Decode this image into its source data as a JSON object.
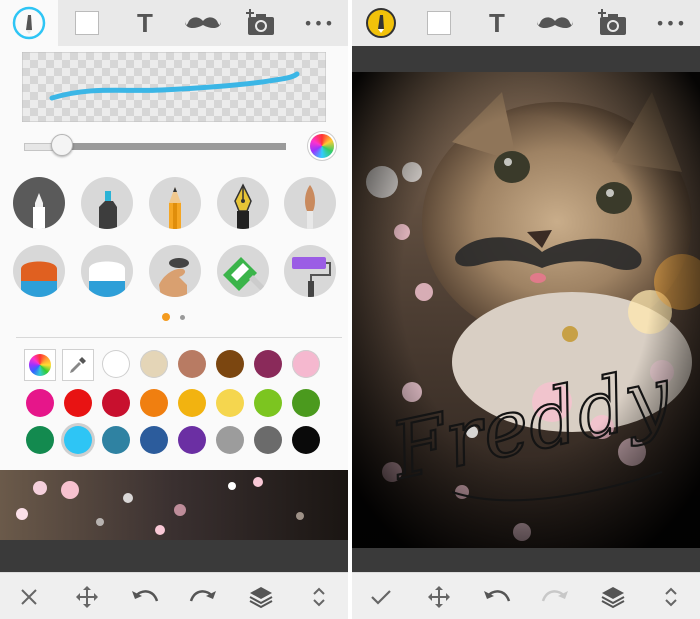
{
  "left": {
    "toolbar": [
      "brush-tool",
      "fill-square",
      "text-tool",
      "mustache-sticker",
      "add-photo",
      "more-options"
    ],
    "text_icon_glyph": "T",
    "more_glyph": "•••",
    "stroke_color": "#3bb6e6",
    "brushes_row1": [
      "marker",
      "highlighter",
      "pencil",
      "fountain-pen",
      "paintbrush"
    ],
    "brushes_row2": [
      "eraser-orange",
      "eraser-white",
      "smudge-finger",
      "glitter-tool",
      "paint-roller"
    ],
    "page_dots": 2,
    "active_page": 1,
    "palette_tools": [
      "color-wheel",
      "eyedropper"
    ],
    "palette": [
      "#ffffff",
      "#e4d5b7",
      "#b87b63",
      "#7b4610",
      "#8a2a5a",
      "#f5b8cf",
      "#e6168a",
      "#e81313",
      "#c8102e",
      "#f07f10",
      "#f2b310",
      "#f5d64e",
      "#7cc520",
      "#4b9a1e",
      "#138a4f",
      "#2ec5f5",
      "#2f82a2",
      "#2c5c9c",
      "#6b2fa3",
      "#9c9c9c",
      "#6b6b6b",
      "#0a0a0a"
    ],
    "selected_color": "#2ec5f5",
    "bottom": [
      "close-icon",
      "move-icon",
      "undo-icon",
      "redo-icon",
      "layers-icon",
      "expand-icon"
    ]
  },
  "right": {
    "toolbar": [
      "brush-tool",
      "fill-square",
      "text-tool",
      "mustache-sticker",
      "add-photo",
      "more-options"
    ],
    "text_icon_glyph": "T",
    "more_glyph": "•••",
    "handwriting": "Freddy",
    "bottom": [
      "check-icon",
      "move-icon",
      "undo-icon",
      "redo-icon",
      "layers-icon",
      "expand-icon"
    ]
  }
}
